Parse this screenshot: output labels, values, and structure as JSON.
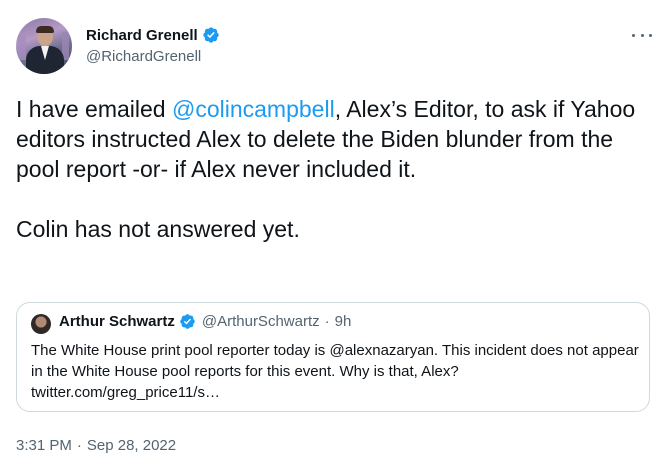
{
  "author": {
    "name": "Richard Grenell",
    "handle": "@RichardGrenell"
  },
  "tweet": {
    "text_before": "I have emailed ",
    "mention": "@colincampbell",
    "text_after": ", Alex’s Editor, to ask if Yahoo editors instructed Alex to delete the Biden blunder from the pool report -or- if Alex never included it.",
    "text_second": "Colin has not answered yet."
  },
  "quoted": {
    "name": "Arthur Schwartz",
    "handle": "@ArthurSchwartz",
    "separator": "·",
    "time": "9h",
    "text": "The White House print pool reporter today is @alexnazaryan. This incident does not appear in the White House pool reports for this event. Why is that, Alex? twitter.com/greg_price11/s…"
  },
  "footer": {
    "time": "3:31 PM",
    "separator": "·",
    "date": "Sep 28, 2022"
  },
  "colors": {
    "verified_badge": "#1d9bf0",
    "mention": "#1d9bf0",
    "secondary_text": "#536471"
  },
  "icons": {
    "verified": "verified-badge-icon",
    "more": "more-options-icon"
  }
}
